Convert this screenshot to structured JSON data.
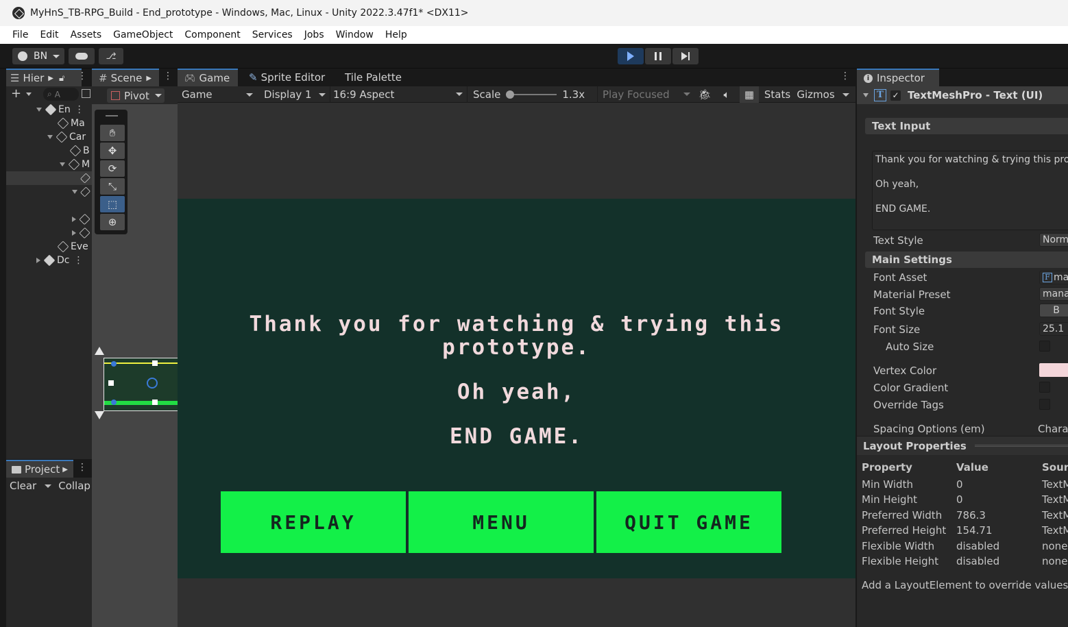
{
  "window": {
    "title": "MyHnS_TB-RPG_Build - End_prototype - Windows, Mac, Linux - Unity 2022.3.47f1* <DX11>"
  },
  "menu": [
    "File",
    "Edit",
    "Assets",
    "GameObject",
    "Component",
    "Services",
    "Jobs",
    "Window",
    "Help"
  ],
  "toolbar": {
    "account": "BN"
  },
  "hierarchy": {
    "tab": "Hier",
    "search_placeholder": "A",
    "rows": [
      "En",
      "Ma",
      "Car",
      "B",
      "M",
      "",
      "",
      "",
      "",
      "Eve",
      "Dc"
    ]
  },
  "project": {
    "tab": "Project",
    "clear": "Clear",
    "collapse": "Collap"
  },
  "scene": {
    "tab": "Scene",
    "pivot": "Pivot"
  },
  "game_tabs": [
    "Game",
    "Sprite Editor",
    "Tile Palette"
  ],
  "game_bar": {
    "view": "Game",
    "display": "Display 1",
    "aspect": "16:9 Aspect",
    "scale_label": "Scale",
    "scale_value": "1.3x",
    "play_mode": "Play Focused",
    "stats": "Stats",
    "gizmos": "Gizmos"
  },
  "game": {
    "line1": "Thank you for watching & trying this",
    "line2": "prototype.",
    "line3": "Oh yeah,",
    "line4": "END GAME.",
    "buttons": [
      "REPLAY",
      "MENU",
      "QUIT GAME"
    ]
  },
  "inspector": {
    "tab": "Inspector",
    "component": "TextMeshPro - Text (UI)",
    "text_input_header": "Text Input",
    "text_input_lines": [
      "Thank you for watching & trying this pro",
      "Oh yeah,",
      "END GAME."
    ],
    "text_style_label": "Text Style",
    "text_style_value": "Norm",
    "main_settings_header": "Main Settings",
    "fields": [
      {
        "label": "Font Asset",
        "value": "ma"
      },
      {
        "label": "Material Preset",
        "value": "mana"
      },
      {
        "label": "Font Style",
        "value": "B"
      },
      {
        "label": "Font Size",
        "value": "25.1"
      },
      {
        "label": "Auto Size",
        "value": ""
      },
      {
        "label": "Vertex Color",
        "value": ""
      },
      {
        "label": "Color Gradient",
        "value": ""
      },
      {
        "label": "Override Tags",
        "value": ""
      },
      {
        "label": "Spacing Options (em)",
        "value": "Chara"
      }
    ],
    "layout_header": "Layout Properties",
    "layout_columns": [
      "Property",
      "Value",
      "Sourc"
    ],
    "layout_rows": [
      [
        "Min Width",
        "0",
        "TextM"
      ],
      [
        "Min Height",
        "0",
        "TextM"
      ],
      [
        "Preferred Width",
        "786.3",
        "TextM"
      ],
      [
        "Preferred Height",
        "154.71",
        "TextM"
      ],
      [
        "Flexible Width",
        "disabled",
        "none"
      ],
      [
        "Flexible Height",
        "disabled",
        "none"
      ]
    ],
    "layout_note": "Add a LayoutElement to override values."
  },
  "colors": {
    "game_bg": "#13312a",
    "button_green": "#13f048",
    "text_pink": "#f1d9dc",
    "vertex_color": "#f4d6da",
    "accent": "#3a79bb"
  }
}
